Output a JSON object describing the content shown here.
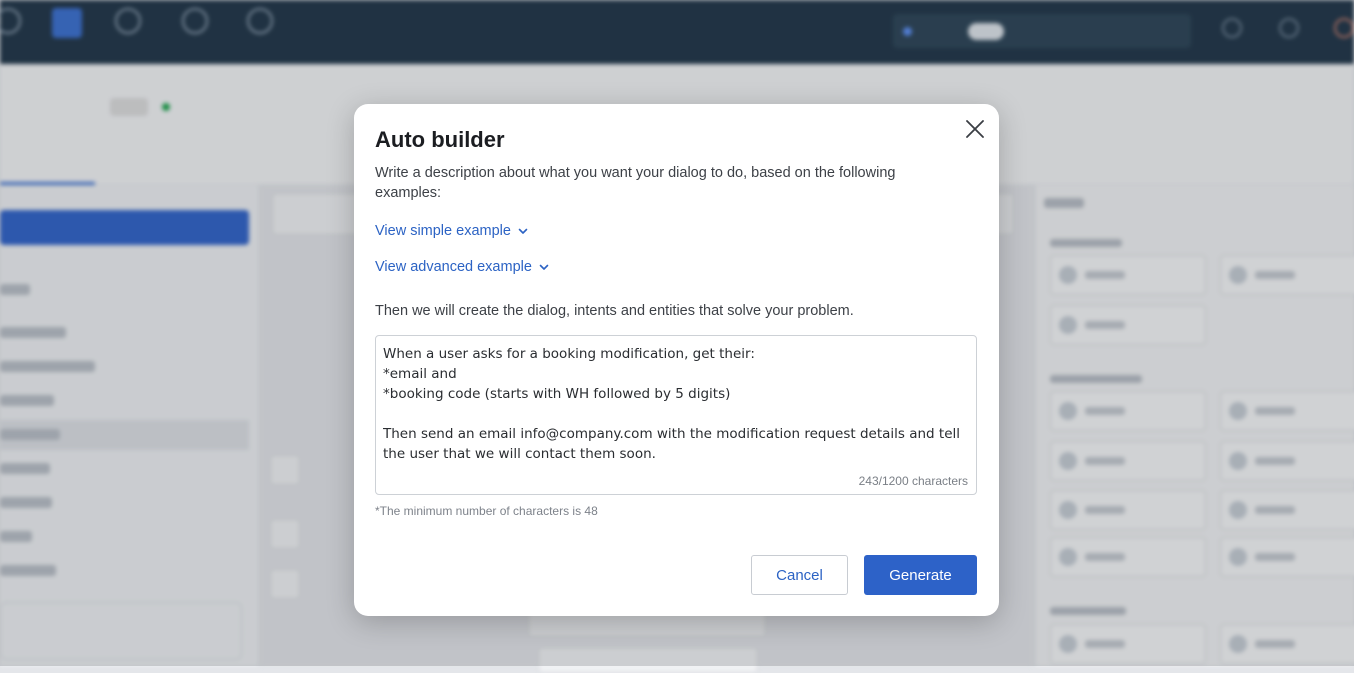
{
  "modal": {
    "title": "Auto builder",
    "description": "Write a description about what you want your dialog to do, based on the following examples:",
    "simple_example_label": "View simple example",
    "advanced_example_label": "View advanced example",
    "then_text": "Then we will create the dialog, intents and entities that solve your problem.",
    "textarea_value": "When a user asks for a booking modification, get their:\n*email and\n*booking code (starts with WH followed by 5 digits)\n\nThen send an email info@company.com with the modification request details and tell the user that we will contact them soon.",
    "char_count": "243/1200 characters",
    "min_note": "*The minimum number of characters is 48",
    "cancel_label": "Cancel",
    "generate_label": "Generate"
  },
  "icons": {
    "close": "close-icon",
    "chevron": "chevron-down-icon"
  },
  "colors": {
    "primary": "#2d62c8",
    "link": "#2c63c4",
    "topbar": "#1f3447"
  }
}
